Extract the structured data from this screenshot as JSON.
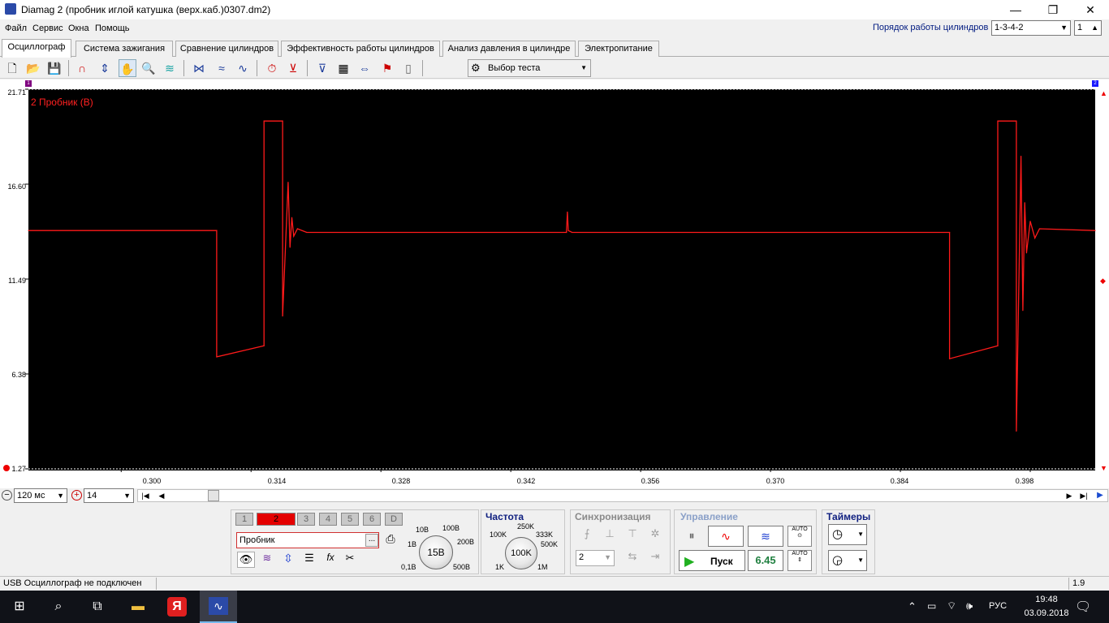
{
  "window": {
    "title": "Diamag 2 (пробник иглой катушка (верх.каб.)0307.dm2)",
    "minimize": "—",
    "maximize": "❐",
    "close": "✕"
  },
  "menu": [
    "Файл",
    "Сервис",
    "Окна",
    "Помощь"
  ],
  "cylinder_order": {
    "label": "Порядок работы цилиндров",
    "value": "1-3-4-2",
    "cyl": "1"
  },
  "tabs": [
    "Осциллограф",
    "Система зажигания",
    "Сравнение цилиндров",
    "Эффективность работы цилиндров",
    "Анализ давления в цилиндре",
    "Электропитание"
  ],
  "toolbar": {
    "test_select": "Выбор теста"
  },
  "channel_label": "2 Пробник (В)",
  "markers": {
    "left": "1",
    "right": "2"
  },
  "chart_data": {
    "type": "line",
    "series": [
      {
        "name": "2 Пробник (В)",
        "color": "#ff1a1a"
      }
    ],
    "xlim": [
      0.29,
      0.405
    ],
    "ylim": [
      1.27,
      21.71
    ],
    "yticks": [
      "21.71",
      "16.60",
      "11.49",
      "6.38",
      "1.27"
    ],
    "xticks": [
      "0.300",
      "0.314",
      "0.328",
      "0.342",
      "0.356",
      "0.370",
      "0.384",
      "0.398"
    ],
    "x": [
      0.29,
      0.3103,
      0.3103,
      0.3154,
      0.3154,
      0.3174,
      0.3174,
      0.318,
      0.3182,
      0.3184,
      0.3186,
      0.319,
      0.32,
      0.348,
      0.3481,
      0.3482,
      0.3486,
      0.3893,
      0.3893,
      0.3945,
      0.3945,
      0.3965,
      0.3965,
      0.397,
      0.3972,
      0.3974,
      0.3976,
      0.398,
      0.3985,
      0.399,
      0.405
    ],
    "y": [
      14.1,
      14.1,
      7.3,
      7.9,
      20.0,
      20.0,
      9.5,
      16.7,
      13.2,
      14.8,
      13.8,
      14.2,
      14.0,
      14.0,
      15.1,
      14.1,
      14.0,
      14.0,
      7.2,
      7.9,
      20.0,
      20.0,
      3.3,
      18.1,
      9.8,
      15.6,
      12.9,
      14.6,
      13.7,
      14.2,
      14.1
    ],
    "grid": false
  },
  "hscroll": {
    "timebase": "120 мс",
    "channel": "14"
  },
  "channels": [
    "1",
    "2",
    "3",
    "4",
    "5",
    "6",
    "D"
  ],
  "probe": {
    "value": "Пробник",
    "more": "..."
  },
  "voltage": {
    "value": "15В",
    "labels": [
      "0,1В",
      "1В",
      "10В",
      "100В",
      "200В",
      "500В"
    ]
  },
  "frequency": {
    "title": "Частота",
    "value": "100K",
    "labels": [
      "1K",
      "100K",
      "250K",
      "333K",
      "500K",
      "1M"
    ]
  },
  "sync": {
    "title": "Синхронизация",
    "value": "2"
  },
  "control": {
    "title": "Управление",
    "run": "Пуск",
    "value": "6.45",
    "auto": "AUTO"
  },
  "timers": {
    "title": "Таймеры"
  },
  "status": {
    "left": "USB Осциллограф не подключен",
    "right": "1.9"
  },
  "taskbar": {
    "lang": "РУС",
    "time": "19:48",
    "date": "03.09.2018"
  }
}
